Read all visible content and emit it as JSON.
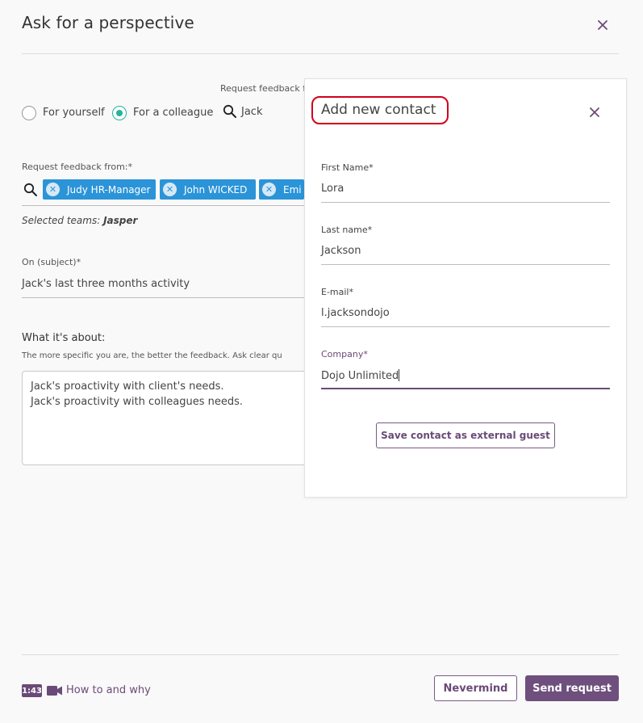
{
  "modal": {
    "title": "Ask for a perspective"
  },
  "mode": {
    "options": [
      {
        "label": "For yourself",
        "selected": false
      },
      {
        "label": "For a colleague",
        "selected": true
      }
    ],
    "request_for_label": "Request feedback f",
    "search_value": "Jack"
  },
  "recipients": {
    "label": "Request feedback from:*",
    "chips": [
      "Judy HR-Manager",
      "John WICKED",
      "Emi"
    ],
    "selected_teams_prefix": "Selected teams:",
    "selected_teams_value": "Jasper"
  },
  "subject": {
    "label": "On (subject)*",
    "value": "Jack's last three months activity"
  },
  "about": {
    "heading": "What it's about:",
    "hint": "The more specific you are, the better the feedback. Ask clear qu",
    "lines": [
      "Jack's proactivity with client's needs.",
      "Jack's proactivity with colleagues needs."
    ]
  },
  "contact_panel": {
    "title": "Add new contact",
    "fields": [
      {
        "label": "First Name*",
        "value": "Lora"
      },
      {
        "label": "Last name*",
        "value": "Jackson"
      },
      {
        "label": "E-mail*",
        "value": "l.jacksondojo"
      },
      {
        "label": "Company*",
        "value": "Dojo Unlimited"
      }
    ],
    "save_label": "Save contact as external guest"
  },
  "footer": {
    "video_duration": "1:43",
    "how_to_label": "How to and why",
    "nevermind_label": "Nevermind",
    "send_label": "Send request"
  },
  "colors": {
    "accent_purple": "#6e4f7d",
    "radio_green": "#27b39a",
    "chip_blue": "#2b94d8",
    "highlight_red": "#d0021b"
  }
}
